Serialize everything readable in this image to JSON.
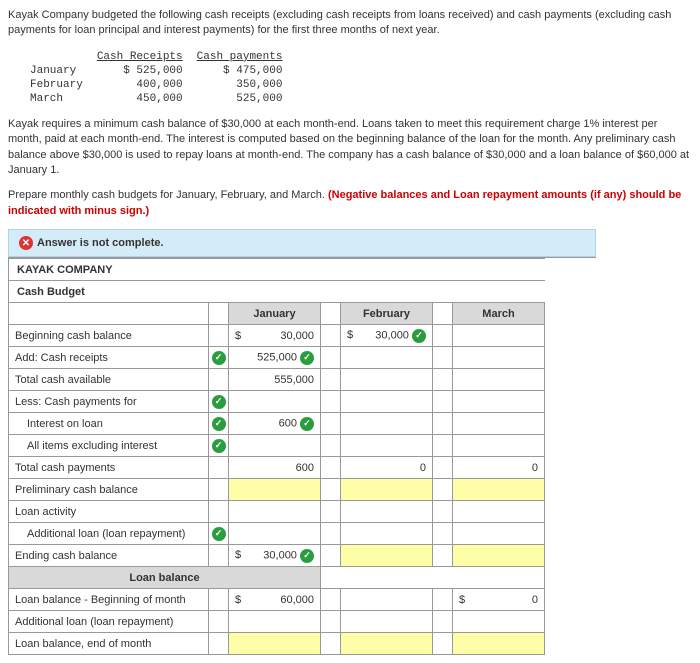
{
  "intro": {
    "p1": "Kayak Company budgeted the following cash receipts (excluding cash receipts from loans received) and cash payments (excluding cash payments for loan principal and interest payments) for the first three months of next year.",
    "table": {
      "h1": "Cash Receipts",
      "h2": "Cash payments",
      "rows": [
        {
          "m": "January",
          "r": "$ 525,000",
          "p": "$ 475,000"
        },
        {
          "m": "February",
          "r": "400,000",
          "p": "350,000"
        },
        {
          "m": "March",
          "r": "450,000",
          "p": "525,000"
        }
      ]
    },
    "p2": "Kayak requires a minimum cash balance of $30,000 at each month-end. Loans taken to meet this requirement charge 1% interest per month, paid at each month-end. The interest is computed based on the beginning balance of the loan for the month. Any preliminary cash balance above $30,000 is used to repay loans at month-end. The company has a cash balance of $30,000 and a loan balance of $60,000 at January 1."
  },
  "instruction": {
    "text": "Prepare monthly cash budgets for January, February, and March. ",
    "red": "(Negative balances and Loan repayment amounts (if any) should be indicated with minus sign.)"
  },
  "banner": "Answer is not complete.",
  "budget": {
    "company": "KAYAK COMPANY",
    "title": "Cash Budget",
    "cols": {
      "jan": "January",
      "feb": "February",
      "mar": "March"
    },
    "rows": {
      "beg": {
        "label": "Beginning cash balance",
        "jan": "30,000",
        "feb": "30,000"
      },
      "add": {
        "label": "Add: Cash receipts",
        "jan": "525,000"
      },
      "avail": {
        "label": "Total cash available",
        "jan": "555,000"
      },
      "less": {
        "label": "Less: Cash payments for"
      },
      "interest": {
        "label": "Interest on loan",
        "jan": "600"
      },
      "all": {
        "label": "All items excluding interest"
      },
      "totpay": {
        "label": "Total cash payments",
        "jan": "600",
        "feb": "0",
        "mar": "0"
      },
      "prelim": {
        "label": "Preliminary cash balance"
      },
      "loanact": {
        "label": "Loan activity"
      },
      "addloan": {
        "label": "Additional loan (loan repayment)"
      },
      "ending": {
        "label": "Ending cash balance",
        "jan": "30,000"
      }
    },
    "loanhdr": "Loan balance",
    "loan": {
      "beg": {
        "label": "Loan balance - Beginning of month",
        "jan": "60,000",
        "mar": "0"
      },
      "add": {
        "label": "Additional loan (loan repayment)"
      },
      "end": {
        "label": "Loan balance, end of month"
      }
    }
  },
  "sym": {
    "dollar": "$",
    "check": "✓",
    "x": "✕"
  }
}
